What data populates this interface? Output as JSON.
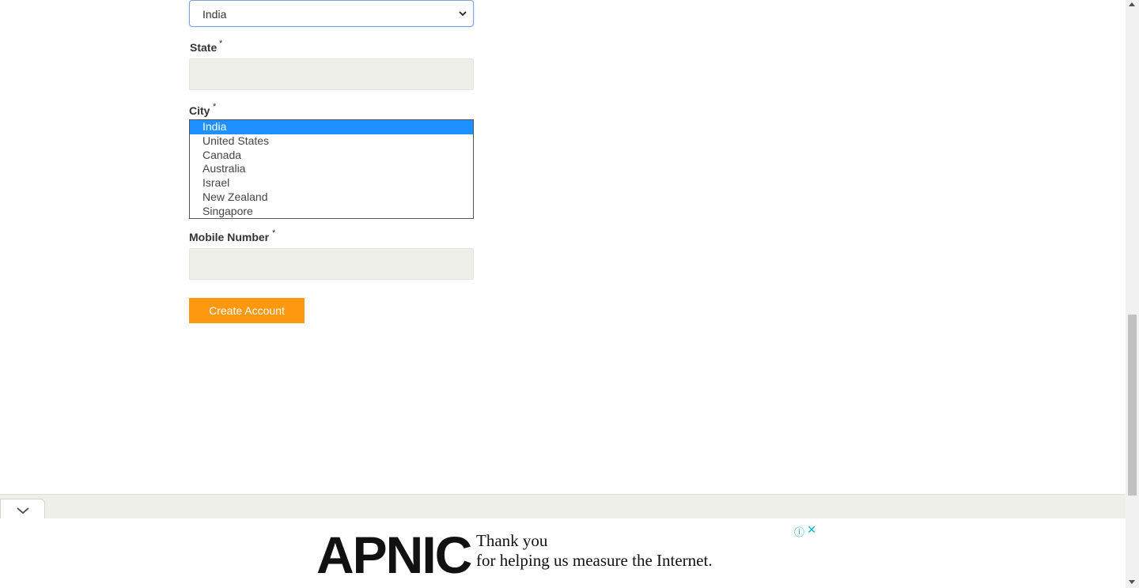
{
  "form": {
    "country": {
      "selected": "India"
    },
    "state": {
      "label": "State",
      "required_mark": "*",
      "value": ""
    },
    "city": {
      "label": "City",
      "required_mark": "*",
      "options": [
        "India",
        "United States",
        "Canada",
        "Australia",
        "Israel",
        "New Zealand",
        "Singapore"
      ],
      "selected": "India"
    },
    "mobile": {
      "label": "Mobile Number",
      "required_mark": "*",
      "value": ""
    },
    "submit_label": "Create Account"
  },
  "ad": {
    "logo": "APNIC",
    "line1": "Thank you",
    "line2": "for helping us measure the Internet.",
    "info_icon": "ⓘ",
    "close_icon": "✕"
  },
  "colors": {
    "button": "#fe980f",
    "selected_option": "#1e90ff",
    "input_bg": "#efefe9"
  }
}
